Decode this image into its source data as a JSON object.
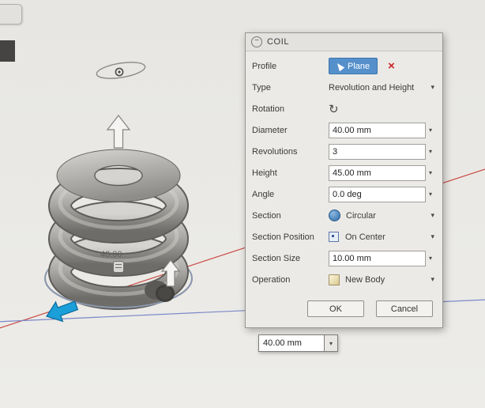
{
  "icons": {
    "collapse": "−",
    "remove": "×",
    "rotation": "↻",
    "dropdown": "▾",
    "spinner": "▾"
  },
  "dialog": {
    "title": "COIL",
    "profile": {
      "label": "Profile",
      "button": "Plane"
    },
    "type": {
      "label": "Type",
      "value": "Revolution and Height"
    },
    "rotation": {
      "label": "Rotation"
    },
    "diameter": {
      "label": "Diameter",
      "value": "40.00 mm"
    },
    "revolutions": {
      "label": "Revolutions",
      "value": "3"
    },
    "height": {
      "label": "Height",
      "value": "45.00 mm"
    },
    "angle": {
      "label": "Angle",
      "value": "0.0 deg"
    },
    "section": {
      "label": "Section",
      "value": "Circular"
    },
    "section_position": {
      "label": "Section Position",
      "value": "On Center"
    },
    "section_size": {
      "label": "Section Size",
      "value": "10.00 mm"
    },
    "operation": {
      "label": "Operation",
      "value": "New Body"
    },
    "ok": "OK",
    "cancel": "Cancel"
  },
  "viewport": {
    "dimension_label": "40.00",
    "floating_input": "40.00 mm"
  },
  "colors": {
    "selection_blue": "#5590cb",
    "axis_red": "#c94a44",
    "axis_blue": "#7b87c9",
    "manipulator_blue": "#1b9fd8"
  }
}
